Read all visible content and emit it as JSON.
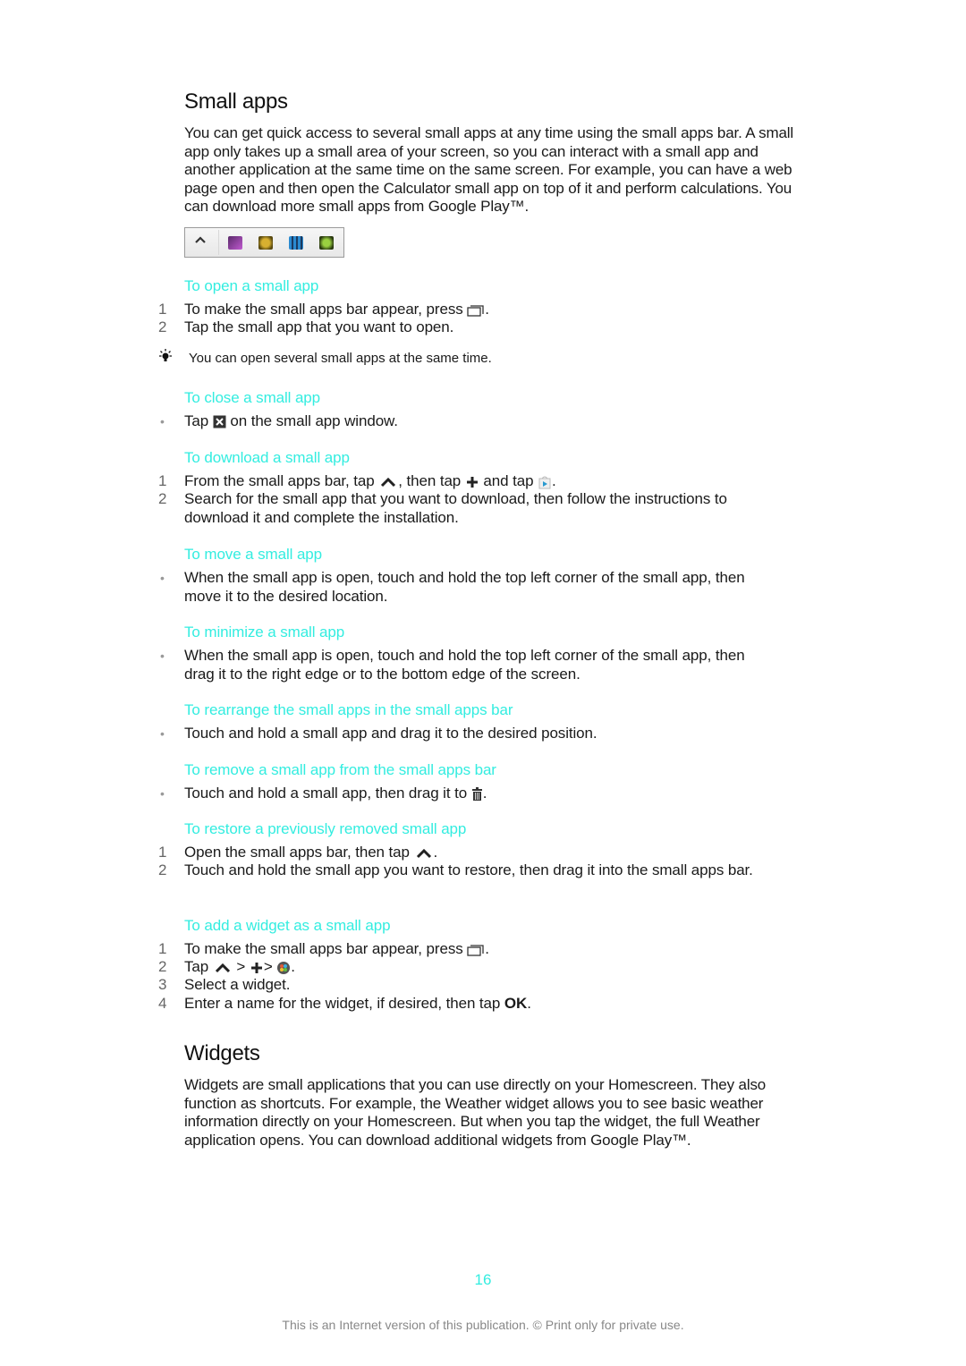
{
  "colors": {
    "accent": "#33ede0",
    "text": "#1a1a1a",
    "muted": "#888888"
  },
  "small_apps": {
    "title": "Small apps",
    "intro": "You can get quick access to several small apps at any time using the small apps bar. A small app only takes up a small area of your screen, so you can interact with a small app and another application at the same time on the same screen. For example, you can have a web page open and then open the Calculator small app on top of it and perform calculations. You can download more small apps from Google Play™.",
    "bar_image": {
      "icons": [
        "chevron-up-icon",
        "eraser-app-icon",
        "timer-app-icon",
        "calculator-app-icon",
        "voice-recorder-app-icon"
      ]
    }
  },
  "sections": {
    "open": {
      "heading": "To open a small app",
      "steps": [
        {
          "n": "1",
          "before": "To make the small apps bar appear, press ",
          "icon": "recent-apps-icon",
          "after": "."
        },
        {
          "n": "2",
          "text": "Tap the small app that you want to open."
        }
      ],
      "tip": "You can open several small apps at the same time."
    },
    "close": {
      "heading": "To close a small app",
      "bullets": [
        {
          "before": "Tap ",
          "icon": "close-icon",
          "after": " on the small app window."
        }
      ]
    },
    "download": {
      "heading": "To download a small app",
      "steps": [
        {
          "n": "1",
          "part1": "From the small apps bar, tap ",
          "part2": ", then tap ",
          "part3": " and tap ",
          "part4": "."
        },
        {
          "n": "2",
          "text": "Search for the small app that you want to download, then follow the instructions to download it and complete the installation."
        }
      ]
    },
    "move": {
      "heading": "To move a small app",
      "bullets": [
        {
          "text": "When the small app is open, touch and hold the top left corner of the small app, then move it to the desired location."
        }
      ]
    },
    "minimize": {
      "heading": "To minimize a small app",
      "bullets": [
        {
          "text": "When the small app is open, touch and hold the top left corner of the small app, then drag it to the right edge or to the bottom edge of the screen."
        }
      ]
    },
    "rearrange": {
      "heading": "To rearrange the small apps in the small apps bar",
      "bullets": [
        {
          "text": "Touch and hold a small app and drag it to the desired position."
        }
      ]
    },
    "remove": {
      "heading": "To remove a small app from the small apps bar",
      "bullets": [
        {
          "before": "Touch and hold a small app, then drag it to ",
          "icon": "trash-icon",
          "after": "."
        }
      ]
    },
    "restore": {
      "heading": "To restore a previously removed small app",
      "steps": [
        {
          "n": "1",
          "before": "Open the small apps bar, then tap ",
          "icon": "chevron-up-icon",
          "after": "."
        },
        {
          "n": "2",
          "text": "Touch and hold the small app you want to restore, then drag it into the small apps bar."
        }
      ]
    },
    "widget": {
      "heading": "To add a widget as a small app",
      "steps": [
        {
          "n": "1",
          "before": "To make the small apps bar appear, press ",
          "icon": "recent-apps-icon",
          "after": "."
        },
        {
          "n": "2",
          "part1": "Tap ",
          "sep1": " > ",
          "sep2": "> ",
          "end": "."
        },
        {
          "n": "3",
          "text": "Select a widget."
        },
        {
          "n": "4",
          "before": "Enter a name for the widget, if desired, then tap ",
          "bold": "OK",
          "after": "."
        }
      ]
    }
  },
  "widgets": {
    "title": "Widgets",
    "intro": "Widgets are small applications that you can use directly on your Homescreen. They also function as shortcuts. For example, the Weather widget allows you to see basic weather information directly on your Homescreen. But when you tap the widget, the full Weather application opens. You can download additional widgets from Google Play™."
  },
  "page_number": "16",
  "footer": "This is an Internet version of this publication. © Print only for private use."
}
